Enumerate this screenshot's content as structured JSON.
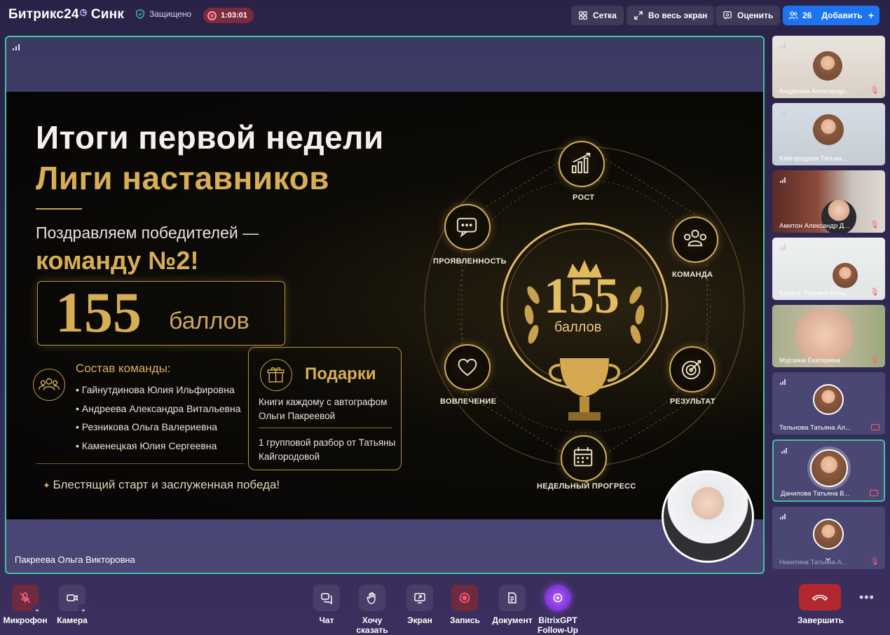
{
  "header": {
    "brand": "Битрикс24",
    "brand_suffix": "Синк",
    "clock_glyph": "◷",
    "secure_label": "Защищено",
    "rec_time": "1:03:01",
    "grid_label": "Сетка",
    "fullscreen_label": "Во весь экран",
    "rate_label": "Оценить",
    "participants_count": "26",
    "add_label": "Добавить",
    "plus_glyph": "+"
  },
  "stage": {
    "speaker_name": "Пакреева Ольга Викторовна",
    "slide": {
      "title_line1": "Итоги первой недели",
      "title_line2": "Лиги наставников",
      "congrats": "Поздравляем победителей —",
      "team": "команду №2!",
      "score": "155",
      "score_unit": "баллов",
      "team_title": "Состав команды:",
      "members": [
        "Гайнутдинова Юлия Ильфировна",
        "Андреева Александра Витальевна",
        "Резникова Ольга Валериевна",
        "Каменецкая Юлия Сергеевна"
      ],
      "slogan": "Блестящий старт и заслуженная победа!",
      "gifts_title": "Подарки",
      "gift1": "Книги каждому с автографом Ольги Пакреевой",
      "gift2": "1 групповой разбор от Татьяны Кайгородовой",
      "wheel": {
        "center_score": "155",
        "center_unit": "баллов",
        "labels": {
          "growth": "РОСТ",
          "team": "КОМАНДА",
          "result": "РЕЗУЛЬТАТ",
          "weekly": "НЕДЕЛЬНЫЙ ПРОГРЕСС",
          "engagement": "ВОВЛЕЧЕНИЕ",
          "activity": "ПРОЯВЛЕННОСТЬ"
        }
      }
    }
  },
  "participants": [
    {
      "name": "Андреева Александр...",
      "state": "mic-off"
    },
    {
      "name": "Кайгородова Татьян...",
      "state": ""
    },
    {
      "name": "Амитон Александр Д...",
      "state": "mic-off"
    },
    {
      "name": "Барель Татьяна Влад...",
      "state": "mic-off"
    },
    {
      "name": "Мурзина Екатерина",
      "state": "mic-off"
    },
    {
      "name": "Тельнова Татьяна Ал...",
      "state": "cam-off"
    },
    {
      "name": "Данилова Татьяна В...",
      "state": "cam-off"
    },
    {
      "name": "Никитина Татьяна А...",
      "state": "mic-off"
    }
  ],
  "controls": {
    "mic": "Микрофон",
    "camera": "Камера",
    "chat": "Чат",
    "raise_hand_1": "Хочу",
    "raise_hand_2": "сказать",
    "screen": "Экран",
    "record": "Запись",
    "document": "Документ",
    "gpt_1": "BitrixGPT",
    "gpt_2": "Follow-Up",
    "end": "Завершить",
    "more": "•••"
  },
  "colors": {
    "accent_blue": "#1e74f0",
    "active_border": "#3fc4a0",
    "end_red": "#b3272f",
    "gold": "#d8ae55"
  }
}
